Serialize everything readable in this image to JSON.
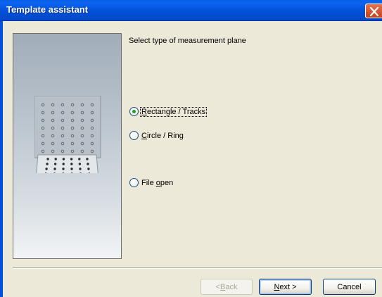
{
  "window": {
    "title": "Template assistant"
  },
  "heading": "Select type of measurement plane",
  "options": [
    {
      "label_pre": "",
      "label_key": "R",
      "label_post": "ectangle / Tracks",
      "checked": true,
      "focused": true
    },
    {
      "label_pre": "",
      "label_key": "C",
      "label_post": "ircle / Ring",
      "checked": false,
      "focused": false
    },
    {
      "label_pre": "File ",
      "label_key": "o",
      "label_post": "pen",
      "checked": false,
      "focused": false
    }
  ],
  "buttons": {
    "back": {
      "pre": "< ",
      "key": "B",
      "post": "ack",
      "enabled": false
    },
    "next": {
      "pre": "",
      "key": "N",
      "post": "ext >",
      "enabled": true
    },
    "cancel": {
      "label": "Cancel",
      "enabled": true
    }
  },
  "icons": {
    "close": "close-icon",
    "illustration": "measurement-plane-illustration"
  },
  "colors": {
    "titlebar": "#0250d8",
    "close_button": "#d9552b",
    "radio_checked_dot": "#21a121"
  }
}
